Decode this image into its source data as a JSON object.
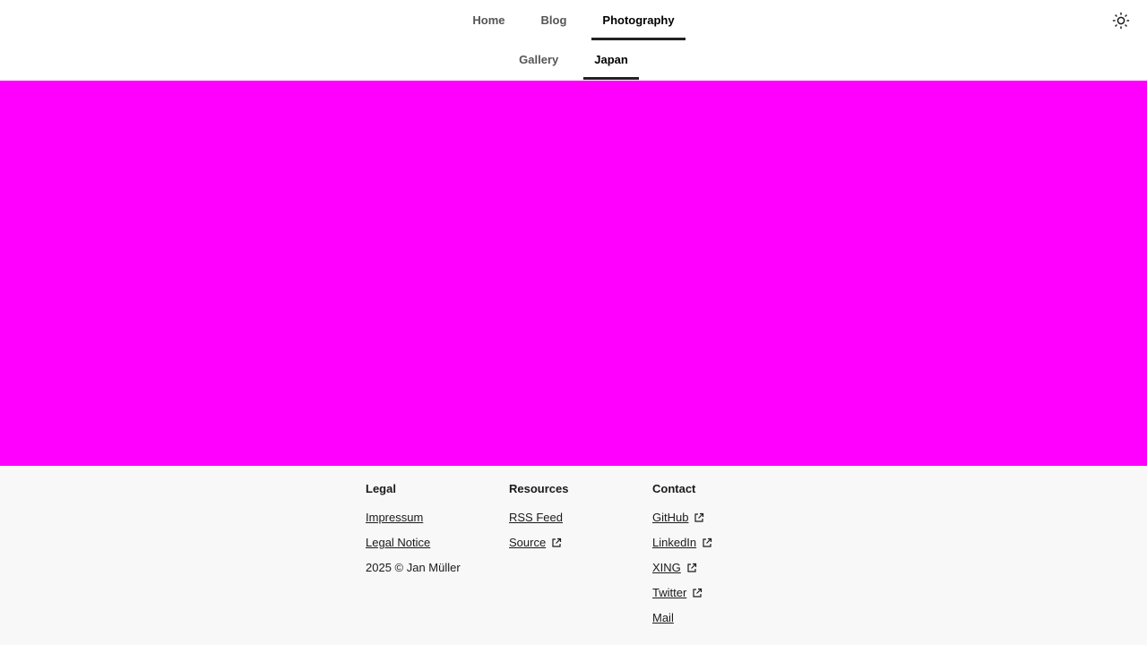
{
  "header": {
    "primary_nav": [
      {
        "label": "Home",
        "active": false
      },
      {
        "label": "Blog",
        "active": false
      },
      {
        "label": "Photography",
        "active": true
      }
    ],
    "secondary_nav": [
      {
        "label": "Gallery",
        "active": false
      },
      {
        "label": "Japan",
        "active": true
      }
    ],
    "theme_toggle_icon": "sun-icon"
  },
  "hero": {
    "color": "#ff00ff"
  },
  "footer": {
    "legal": {
      "heading": "Legal",
      "links": [
        "Impressum",
        "Legal Notice"
      ],
      "copyright": "2025 © Jan Müller"
    },
    "resources": {
      "heading": "Resources",
      "links": [
        {
          "label": "RSS Feed",
          "external": false
        },
        {
          "label": "Source",
          "external": true
        }
      ]
    },
    "contact": {
      "heading": "Contact",
      "links": [
        {
          "label": "GitHub",
          "external": true
        },
        {
          "label": "LinkedIn",
          "external": true
        },
        {
          "label": "XING",
          "external": true
        },
        {
          "label": "Twitter",
          "external": true
        },
        {
          "label": "Mail",
          "external": false
        }
      ]
    },
    "external_icon": "external-link-icon"
  }
}
